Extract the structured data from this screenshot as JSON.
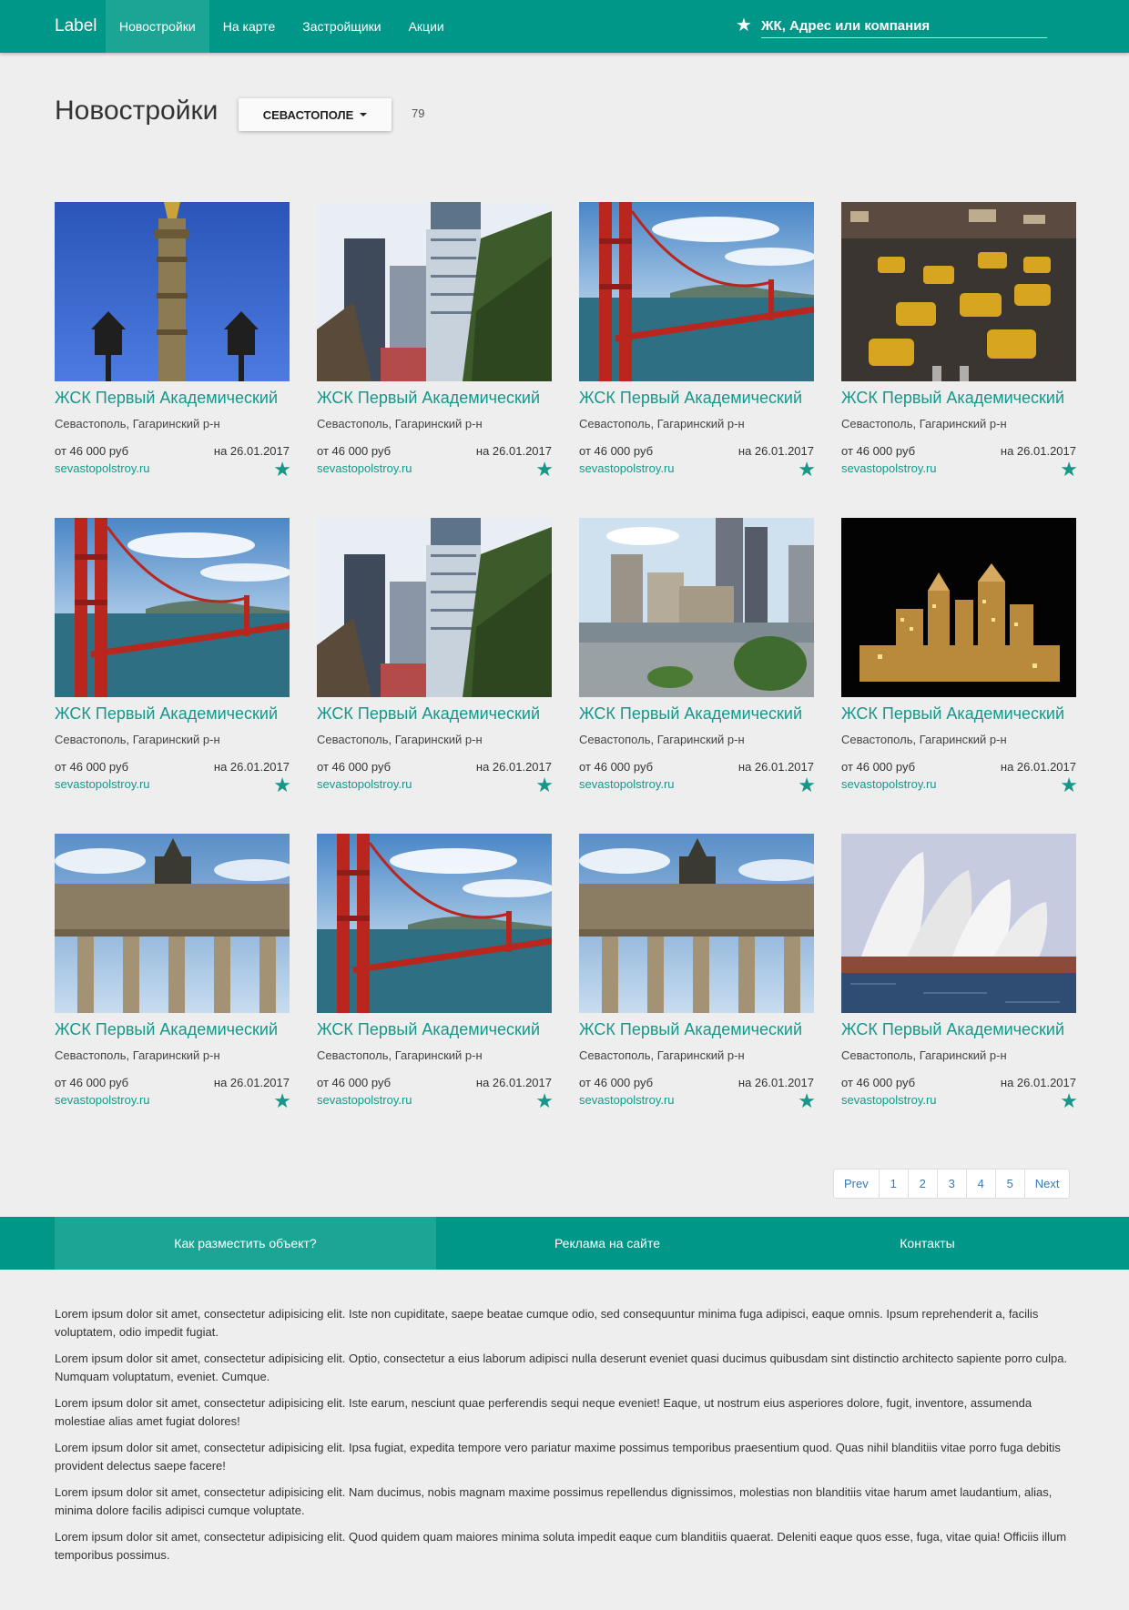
{
  "navbar": {
    "brand": "Label",
    "items": [
      {
        "label": "Новостройки"
      },
      {
        "label": "На карте"
      },
      {
        "label": "Застройщики"
      },
      {
        "label": "Акции"
      }
    ],
    "search_placeholder": "ЖК, Адрес или компания"
  },
  "header": {
    "title": "Новостройки",
    "city_button": "СЕВАСТОПОЛЕ",
    "count": "79"
  },
  "listings": [
    {
      "image": "tower",
      "title": "ЖСК Первый Академический",
      "address": "Севастополь, Гагаринский р-н",
      "price": "от 46 000 руб",
      "date": "на 26.01.2017",
      "site": "sevastopolstroy.ru"
    },
    {
      "image": "skyscrapers",
      "title": "ЖСК Первый Академический",
      "address": "Севастополь, Гагаринский р-н",
      "price": "от 46 000 руб",
      "date": "на 26.01.2017",
      "site": "sevastopolstroy.ru"
    },
    {
      "image": "bridge",
      "title": "ЖСК Первый Академический",
      "address": "Севастополь, Гагаринский р-н",
      "price": "от 46 000 руб",
      "date": "на 26.01.2017",
      "site": "sevastopolstroy.ru"
    },
    {
      "image": "taxis",
      "title": "ЖСК Первый Академический",
      "address": "Севастополь, Гагаринский р-н",
      "price": "от 46 000 руб",
      "date": "на 26.01.2017",
      "site": "sevastopolstroy.ru"
    },
    {
      "image": "bridge",
      "title": "ЖСК Первый Академический",
      "address": "Севастополь, Гагаринский р-н",
      "price": "от 46 000 руб",
      "date": "на 26.01.2017",
      "site": "sevastopolstroy.ru"
    },
    {
      "image": "skyscrapers",
      "title": "ЖСК Первый Академический",
      "address": "Севастополь, Гагаринский р-н",
      "price": "от 46 000 руб",
      "date": "на 26.01.2017",
      "site": "sevastopolstroy.ru"
    },
    {
      "image": "city",
      "title": "ЖСК Первый Академический",
      "address": "Севастополь, Гагаринский р-н",
      "price": "от 46 000 руб",
      "date": "на 26.01.2017",
      "site": "sevastopolstroy.ru"
    },
    {
      "image": "night",
      "title": "ЖСК Первый Академический",
      "address": "Севастополь, Гагаринский р-н",
      "price": "от 46 000 руб",
      "date": "на 26.01.2017",
      "site": "sevastopolstroy.ru"
    },
    {
      "image": "gate",
      "title": "ЖСК Первый Академический",
      "address": "Севастополь, Гагаринский р-н",
      "price": "от 46 000 руб",
      "date": "на 26.01.2017",
      "site": "sevastopolstroy.ru"
    },
    {
      "image": "bridge",
      "title": "ЖСК Первый Академический",
      "address": "Севастополь, Гагаринский р-н",
      "price": "от 46 000 руб",
      "date": "на 26.01.2017",
      "site": "sevastopolstroy.ru"
    },
    {
      "image": "gate",
      "title": "ЖСК Первый Академический",
      "address": "Севастополь, Гагаринский р-н",
      "price": "от 46 000 руб",
      "date": "на 26.01.2017",
      "site": "sevastopolstroy.ru"
    },
    {
      "image": "opera",
      "title": "ЖСК Первый Академический",
      "address": "Севастополь, Гагаринский р-н",
      "price": "от 46 000 руб",
      "date": "на 26.01.2017",
      "site": "sevastopolstroy.ru"
    }
  ],
  "pagination": {
    "prev": "Prev",
    "pages": [
      "1",
      "2",
      "3",
      "4",
      "5"
    ],
    "next": "Next"
  },
  "footer_nav": {
    "items": [
      {
        "label": "Как разместить объект?"
      },
      {
        "label": "Реклама на сайте"
      },
      {
        "label": "Контакты"
      }
    ]
  },
  "paragraphs": [
    "Lorem ipsum dolor sit amet, consectetur adipisicing elit. Iste non cupiditate, saepe beatae cumque odio, sed consequuntur minima fuga adipisci, eaque omnis. Ipsum reprehenderit a, facilis voluptatem, odio impedit fugiat.",
    "Lorem ipsum dolor sit amet, consectetur adipisicing elit. Optio, consectetur a eius laborum adipisci nulla deserunt eveniet quasi ducimus quibusdam sint distinctio architecto sapiente porro culpa. Numquam voluptatum, eveniet. Cumque.",
    "Lorem ipsum dolor sit amet, consectetur adipisicing elit. Iste earum, nesciunt quae perferendis sequi neque eveniet! Eaque, ut nostrum eius asperiores dolore, fugit, inventore, assumenda molestiae alias amet fugiat dolores!",
    "Lorem ipsum dolor sit amet, consectetur adipisicing elit. Ipsa fugiat, expedita tempore vero pariatur maxime possimus temporibus praesentium quod. Quas nihil blanditiis vitae porro fuga debitis provident delectus saepe facere!",
    "Lorem ipsum dolor sit amet, consectetur adipisicing elit. Nam ducimus, nobis magnam maxime possimus repellendus dignissimos, molestias non blanditiis vitae harum amet laudantium, alias, minima dolore facilis adipisci cumque voluptate.",
    "Lorem ipsum dolor sit amet, consectetur adipisicing elit. Quod quidem quam maiores minima soluta impedit eaque cum blanditiis quaerat. Deleniti eaque quos esse, fuga, vitae quia! Officiis illum temporibus possimus."
  ],
  "colors": {
    "primary": "#009688",
    "primary_light": "#1aa595",
    "link": "#15988a",
    "background": "#eeeeee"
  }
}
